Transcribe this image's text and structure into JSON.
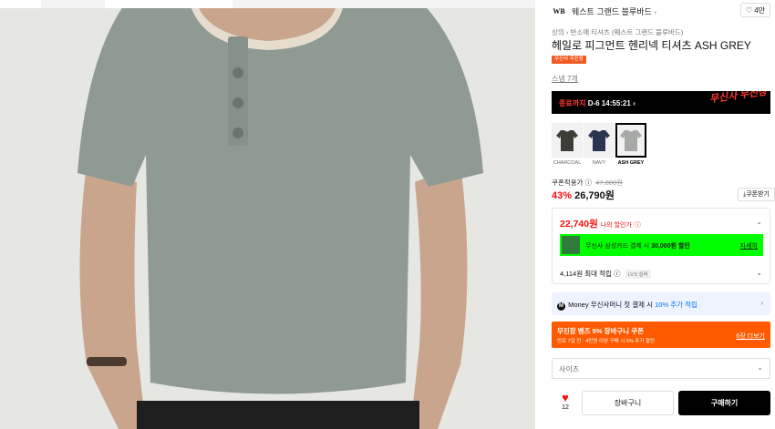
{
  "brand": {
    "logo": "WB",
    "name": "웨스트 그랜드 블루바드",
    "arrow": "›"
  },
  "like": {
    "icon": "heart-outline-icon",
    "count": "4만"
  },
  "breadcrumb": "상의 › 반소매 티셔츠 (웨스트 그랜드 블루바드)",
  "product": {
    "title": "헤일로 피그먼트 헨리넥 티셔츠 ASH GREY",
    "tag": "무신사 무진장",
    "reviews": "스냅 7개"
  },
  "banner": {
    "prefix": "종료까지",
    "countdown": "D-6 14:55:21",
    "arrow": "›",
    "logo": "무신사 무진장"
  },
  "swatches": [
    {
      "label": "CHARCOAL",
      "color": "#3b3d36",
      "selected": false
    },
    {
      "label": "NAVY",
      "color": "#2b3550",
      "selected": false
    },
    {
      "label": "ASH GREY",
      "color": "#a7a9a6",
      "selected": true
    }
  ],
  "price": {
    "coupon_label": "쿠폰적용가",
    "original": "47,000원",
    "discount": "43%",
    "final": "26,790원",
    "coupon_button": "쿠폰받기"
  },
  "benefit": {
    "my_price": "22,740원",
    "my_price_label": "나의 할인가",
    "card_text_pre": "무신사 삼성카드 결제 시",
    "card_text_bold": "30,000원 할인",
    "card_more": "자세히",
    "points": "4,114원 최대 적립",
    "level": "LV.5 실버"
  },
  "money": {
    "badge": "M",
    "text_pre": "Money 무신사머니 첫 결제 시",
    "text_blue": "10% 추가 적립"
  },
  "promo": {
    "title": "무진장 벤즈 5% 장바구니 쿠폰",
    "subtitle": "만료 7일 전 · 4만원 이상 구매 시 5% 추가 할인",
    "more": "6장 더보기"
  },
  "size": {
    "placeholder": "사이즈"
  },
  "actions": {
    "like_count": "12",
    "cart": "장바구니",
    "buy": "구매하기"
  }
}
